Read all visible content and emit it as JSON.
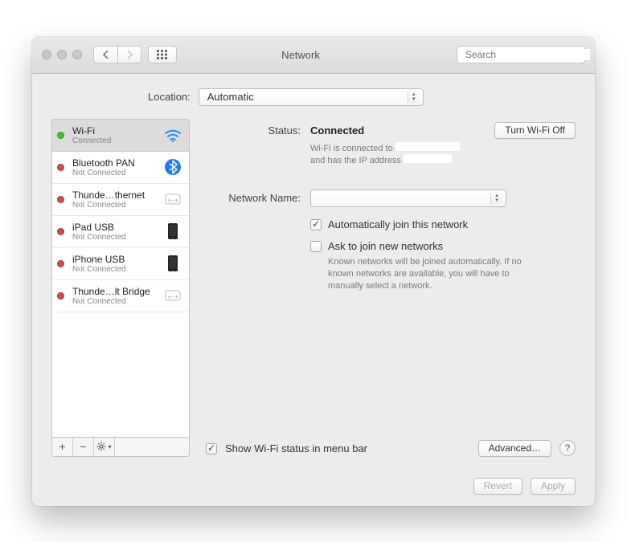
{
  "window": {
    "title": "Network"
  },
  "toolbar": {
    "search_placeholder": "Search"
  },
  "location": {
    "label": "Location:",
    "value": "Automatic"
  },
  "sidebar": {
    "services": [
      {
        "name": "Wi-Fi",
        "status": "Connected",
        "state": "green",
        "icon": "wifi",
        "selected": true
      },
      {
        "name": "Bluetooth PAN",
        "status": "Not Connected",
        "state": "red",
        "icon": "bluetooth"
      },
      {
        "name": "Thunde…thernet",
        "status": "Not Connected",
        "state": "red",
        "icon": "thunder"
      },
      {
        "name": "iPad USB",
        "status": "Not Connected",
        "state": "red",
        "icon": "device"
      },
      {
        "name": "iPhone USB",
        "status": "Not Connected",
        "state": "red",
        "icon": "device"
      },
      {
        "name": "Thunde…lt Bridge",
        "status": "Not Connected",
        "state": "red",
        "icon": "thunder"
      }
    ]
  },
  "detail": {
    "status_label": "Status:",
    "status_value": "Connected",
    "wifi_toggle": "Turn Wi-Fi Off",
    "status_sub1": "Wi-Fi is connected to",
    "status_sub2": "and has the IP address",
    "netname_label": "Network Name:",
    "netname_value": "",
    "auto_join": "Automatically join this network",
    "ask_join": "Ask to join new networks",
    "ask_help": "Known networks will be joined automatically. If no known networks are available, you will have to manually select a network.",
    "menubar": "Show Wi-Fi status in menu bar",
    "advanced": "Advanced…",
    "help": "?"
  },
  "footer": {
    "revert": "Revert",
    "apply": "Apply"
  }
}
